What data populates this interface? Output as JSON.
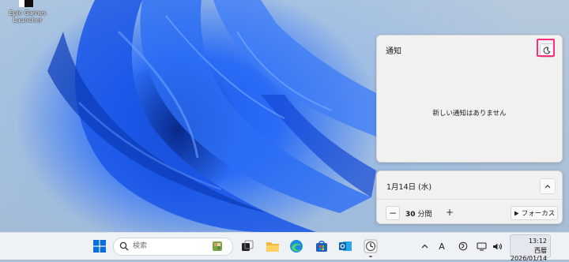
{
  "desktop": {
    "icon_label_line1": "Epic Games",
    "icon_label_line2": "Launcher"
  },
  "notifications": {
    "title": "通知",
    "empty_message": "新しい通知はありません"
  },
  "calendar": {
    "date": "1月14日 (水)",
    "focus_minutes": "30",
    "focus_unit": "分間",
    "focus_button": "フォーカス"
  },
  "taskbar": {
    "search_placeholder": "検索",
    "ime_label": "A",
    "time": "13:12",
    "date": "西暦2026/01/14"
  },
  "colors": {
    "highlight": "#ff2e7a",
    "accent": "#0067c0"
  }
}
